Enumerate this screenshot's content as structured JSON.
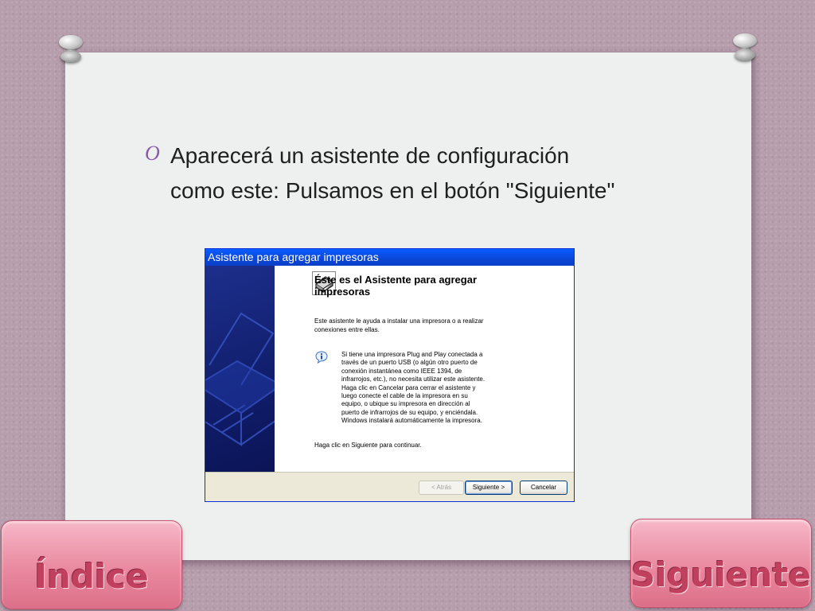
{
  "slide": {
    "bullet_glyph": "O",
    "bullet_line1": "Aparecerá un asistente de configuración",
    "bullet_line2": "como este: Pulsamos en el botón \"Siguiente\""
  },
  "wizard": {
    "title": "Asistente para agregar impresoras",
    "heading_line1": "Éste es el Asistente para agregar",
    "heading_line2": "impresoras",
    "intro_line1": "Este asistente le ayuda a instalar una impresora o a realizar",
    "intro_line2": "conexiones entre ellas.",
    "info_lines": [
      "Si tiene una impresora Plug and Play conectada a",
      "través de un puerto USB (o algún otro puerto de",
      "conexión instantánea como IEEE 1394, de",
      "infrarrojos, etc.), no necesita utilizar este asistente.",
      "Haga clic en Cancelar para cerrar el asistente y",
      "luego conecte el cable de la impresora en su",
      "equipo, o ubique su impresora en dirección al",
      "puerto de infrarrojos de su equipo, y enciéndala.",
      "Windows instalará automáticamente la impresora."
    ],
    "continue_text": "Haga clic en Siguiente para continuar.",
    "buttons": {
      "back": "< Atrás",
      "next": "Siguiente >",
      "cancel": "Cancelar"
    },
    "icons": {
      "printer": "printer-icon",
      "info": "info-icon"
    }
  },
  "nav": {
    "index_label": "Índice",
    "next_label": "Siguiente"
  },
  "colors": {
    "background": "#b79ead",
    "card": "#eef0f0",
    "bullet": "#8a5aa8",
    "titlebar": "#0a50e6",
    "nav_button": "#e9899f",
    "nav_text": "#c0405e"
  }
}
